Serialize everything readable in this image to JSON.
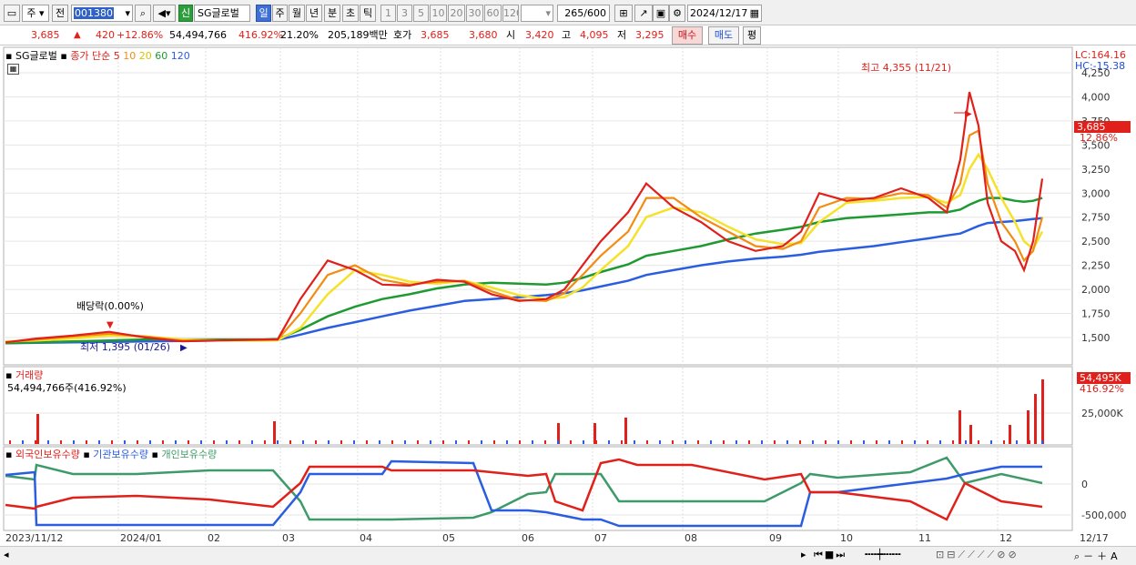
{
  "toolbar": {
    "period_main": "주",
    "jeon": "전",
    "code": "001380",
    "badge_new": "신",
    "stock_name": "SG글로벌",
    "periods": [
      "일",
      "주",
      "월",
      "년",
      "분",
      "초",
      "틱"
    ],
    "selected_period": "일",
    "intervals": [
      "1",
      "3",
      "5",
      "10",
      "20",
      "30",
      "60",
      "120"
    ],
    "count": "265",
    "total": "/600",
    "date": "2024/12/17"
  },
  "quote": {
    "price": "3,685",
    "change_arrow": "▲",
    "change": "420",
    "change_pct": "+12.86%",
    "volume": "54,494,766",
    "volume_ratio": "416.92%",
    "turnover": "21.20%",
    "amount": "205,189백만",
    "hoga_label": "호가",
    "ask": "3,685",
    "bid": "3,680",
    "open_label": "시",
    "open": "3,420",
    "high_label": "고",
    "high": "4,095",
    "low_label": "저",
    "low": "3,295",
    "buy_label": "매수",
    "sell_label": "매도",
    "eval_label": "평"
  },
  "price_panel": {
    "stock_label": "SG글로벌",
    "ma_label": "종가 단순",
    "ma_periods": [
      "5",
      "10",
      "20",
      "60",
      "120"
    ],
    "lc": "LC:164.16",
    "hc": "HC:-15.38",
    "current_box": "3,685",
    "current_pct": "12.86%",
    "high_annotation": "최고 4,355 (11/21)",
    "low_annotation": "최저 1,395 (01/26)",
    "dividend_annotation": "배당락(0.00%)",
    "y_ticks": [
      "4,250",
      "4,000",
      "3,750",
      "3,500",
      "3,250",
      "3,000",
      "2,750",
      "2,500",
      "2,250",
      "2,000",
      "1,750",
      "1,500"
    ]
  },
  "volume_panel": {
    "label": "거래량",
    "value_line": "54,494,766주(416.92%)",
    "box_value": "54,495K",
    "box_pct": "416.92%",
    "tick": "25,000K"
  },
  "holding_panel": {
    "foreign": "외국인보유수량",
    "institution": "기관보유수량",
    "individual": "개인보유수량",
    "ticks": [
      "0",
      "-500,000"
    ]
  },
  "x_axis": [
    "2023/11/12",
    "2024/01",
    "02",
    "03",
    "04",
    "05",
    "06",
    "07",
    "08",
    "09",
    "10",
    "11",
    "12",
    "12/17"
  ],
  "colors": {
    "ma5": "#e0201b",
    "ma10": "#f28c12",
    "ma20": "#f5e22a",
    "ma60": "#1f9a32",
    "ma120": "#2a5de0",
    "foreign": "#e0201b",
    "institution": "#2a5de0",
    "individual": "#3f9a6a"
  }
}
